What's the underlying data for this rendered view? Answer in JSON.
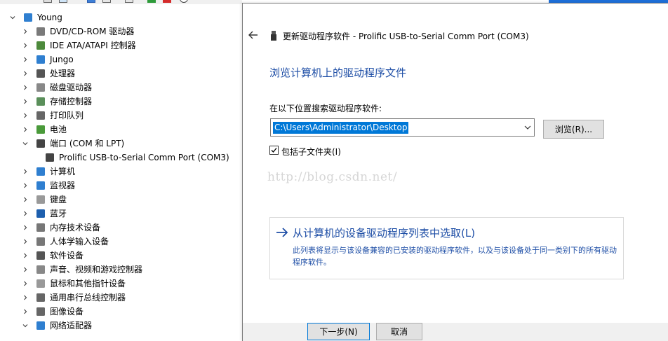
{
  "device_manager": {
    "root": "Young",
    "items": [
      {
        "label": "DVD/CD-ROM 驱动器",
        "expanded": false,
        "icon": "dvd-drive-icon"
      },
      {
        "label": "IDE ATA/ATAPI 控制器",
        "expanded": false,
        "icon": "ide-controller-icon"
      },
      {
        "label": "Jungo",
        "expanded": false,
        "icon": "jungo-icon"
      },
      {
        "label": "处理器",
        "expanded": false,
        "icon": "processor-icon"
      },
      {
        "label": "磁盘驱动器",
        "expanded": false,
        "icon": "disk-drive-icon"
      },
      {
        "label": "存储控制器",
        "expanded": false,
        "icon": "storage-controller-icon"
      },
      {
        "label": "打印队列",
        "expanded": false,
        "icon": "print-queue-icon"
      },
      {
        "label": "电池",
        "expanded": false,
        "icon": "battery-icon"
      },
      {
        "label": "端口 (COM 和 LPT)",
        "expanded": true,
        "icon": "port-icon"
      },
      {
        "label": "Prolific USB-to-Serial Comm Port (COM3)",
        "child": true,
        "icon": "usb-serial-port-icon"
      },
      {
        "label": "计算机",
        "expanded": false,
        "icon": "computer-icon"
      },
      {
        "label": "监视器",
        "expanded": false,
        "icon": "monitor-icon"
      },
      {
        "label": "键盘",
        "expanded": false,
        "icon": "keyboard-icon"
      },
      {
        "label": "蓝牙",
        "expanded": false,
        "icon": "bluetooth-icon"
      },
      {
        "label": "内存技术设备",
        "expanded": false,
        "icon": "memory-device-icon"
      },
      {
        "label": "人体学输入设备",
        "expanded": false,
        "icon": "hid-icon"
      },
      {
        "label": "软件设备",
        "expanded": false,
        "icon": "software-device-icon"
      },
      {
        "label": "声音、视频和游戏控制器",
        "expanded": false,
        "icon": "speaker-icon"
      },
      {
        "label": "鼠标和其他指针设备",
        "expanded": false,
        "icon": "mouse-icon"
      },
      {
        "label": "通用串行总线控制器",
        "expanded": false,
        "icon": "usb-controller-icon"
      },
      {
        "label": "图像设备",
        "expanded": false,
        "icon": "imaging-device-icon"
      },
      {
        "label": "网络适配器",
        "expanded": true,
        "icon": "network-adapter-icon"
      }
    ]
  },
  "dialog": {
    "title": "更新驱动程序软件 - Prolific USB-to-Serial Comm Port (COM3)",
    "heading": "浏览计算机上的驱动程序文件",
    "search_label": "在以下位置搜索驱动程序软件:",
    "path_value": "C:\\Users\\Administrator\\Desktop",
    "browse_label": "浏览(R)...",
    "include_subfolders_label": "包括子文件夹(I)",
    "include_subfolders_checked": true,
    "watermark": "http://blog.csdn.net/",
    "pick_title": "从计算机的设备驱动程序列表中选取(L)",
    "pick_description": "此列表将显示与该设备兼容的已安装的驱动程序软件，以及与该设备处于同一类别下的所有驱动程序软件。",
    "next_label": "下一步(N)",
    "cancel_label": "取消"
  },
  "colors": {
    "link_blue": "#1e4ea6",
    "selection_blue": "#0078d7"
  }
}
